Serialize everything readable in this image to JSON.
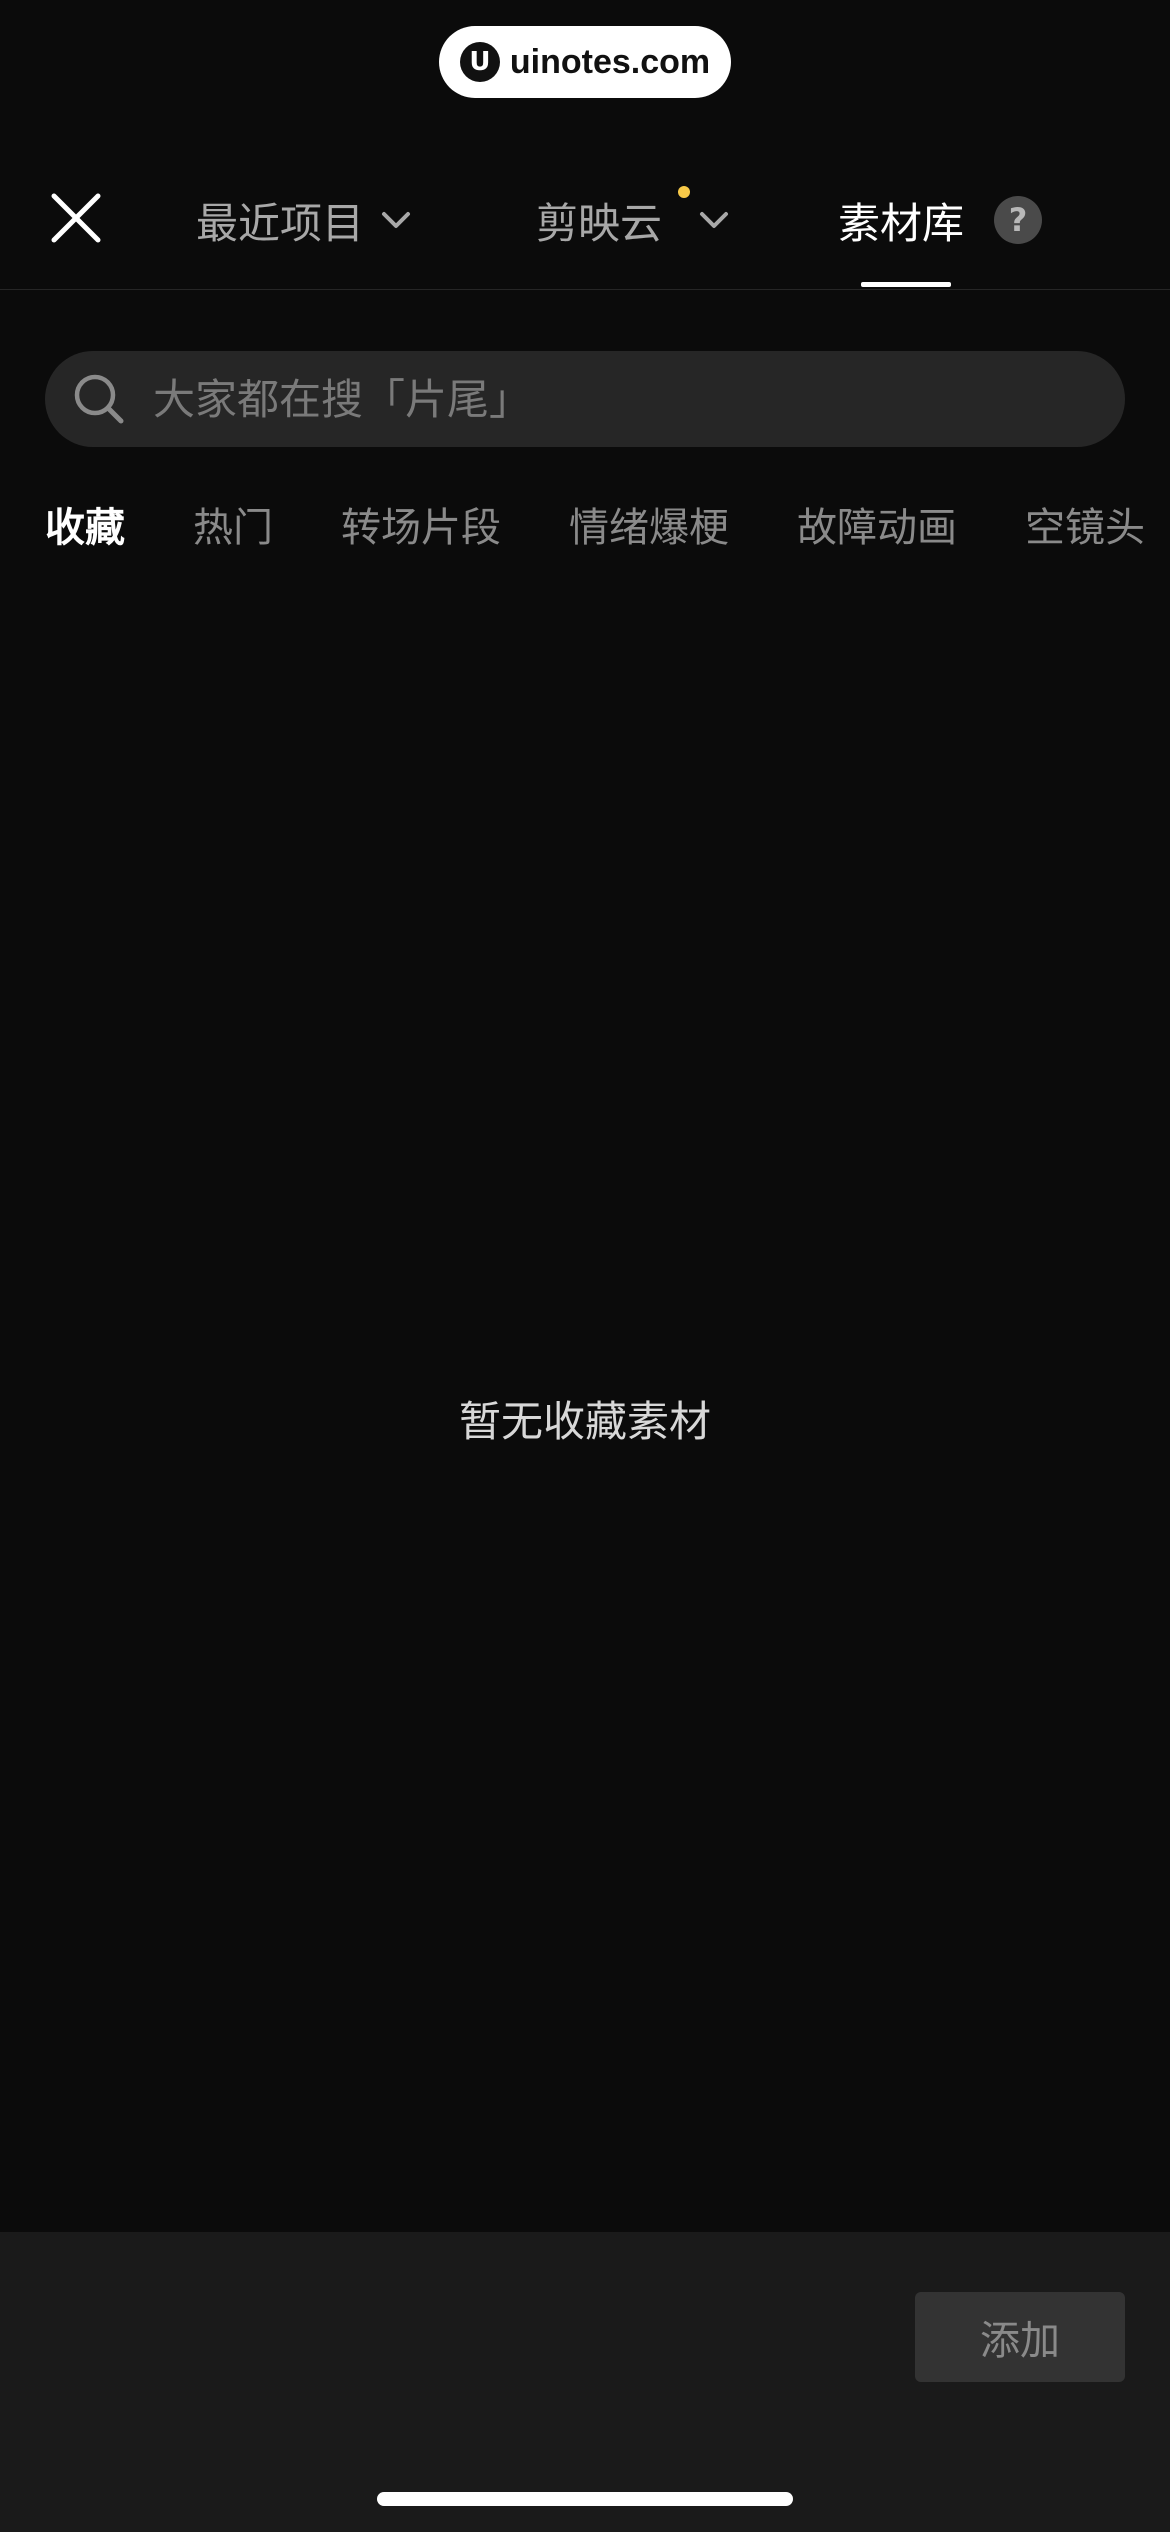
{
  "watermark": {
    "logo_letter": "U",
    "text": "uinotes.com"
  },
  "tabs": {
    "recent": {
      "label": "最近项目"
    },
    "cloud": {
      "label": "剪映云",
      "dot_color": "#f7c948"
    },
    "library": {
      "label": "素材库",
      "help": "?"
    }
  },
  "search": {
    "placeholder": "大家都在搜「片尾」",
    "value": ""
  },
  "categories": [
    "收藏",
    "热门",
    "转场片段",
    "情绪爆梗",
    "故障动画",
    "空镜头"
  ],
  "empty_state": {
    "text": "暂无收藏素材"
  },
  "footer": {
    "add_label": "添加"
  },
  "colors": {
    "background": "#0b0b0b",
    "panel": "#1a1a1a",
    "accent_dot": "#f7c948"
  }
}
